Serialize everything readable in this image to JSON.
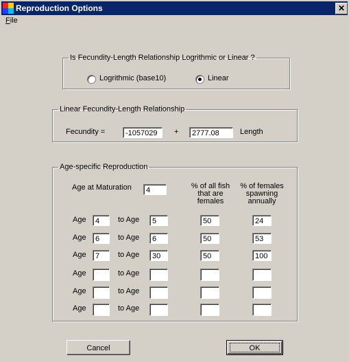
{
  "window": {
    "title": "Reproduction Options",
    "close_glyph": "✕"
  },
  "menu": {
    "file_mnemonic": "F",
    "file_rest": "ile"
  },
  "relationship_type": {
    "legend": "Is Fecundity-Length Relationship Logrithmic or Linear ?",
    "options": [
      {
        "label": "Logrithmic (base10)",
        "checked": false
      },
      {
        "label": "Linear",
        "checked": true
      }
    ]
  },
  "linear": {
    "legend": "Linear Fecundity-Length Relationship",
    "fecundity_label": "Fecundity =",
    "intercept": "-1057029",
    "plus": "+",
    "slope": "2777.08",
    "length_label": "Length"
  },
  "age_specific": {
    "legend": "Age-specific Reproduction",
    "maturation_label": "Age at Maturation",
    "maturation_value": "4",
    "col_female_pct": [
      "% of all fish",
      "that are",
      "females"
    ],
    "col_spawning_pct": [
      "% of females",
      "spawning",
      "annually"
    ],
    "age_label": "Age",
    "to_age_label": "to Age",
    "rows": [
      {
        "from": "4",
        "to": "5",
        "female": "50",
        "spawn": "24"
      },
      {
        "from": "6",
        "to": "6",
        "female": "50",
        "spawn": "53"
      },
      {
        "from": "7",
        "to": "30",
        "female": "50",
        "spawn": "100"
      },
      {
        "from": "",
        "to": "",
        "female": "",
        "spawn": ""
      },
      {
        "from": "",
        "to": "",
        "female": "",
        "spawn": ""
      },
      {
        "from": "",
        "to": "",
        "female": "",
        "spawn": ""
      }
    ]
  },
  "buttons": {
    "cancel": "Cancel",
    "ok": "OK"
  }
}
